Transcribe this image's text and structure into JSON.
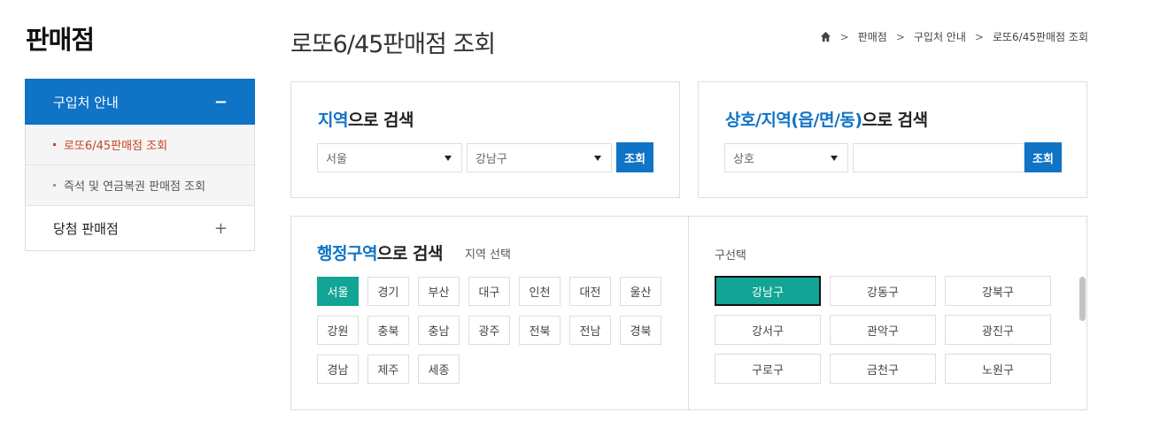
{
  "side_title": "판매점",
  "page_title": "로또6/45판매점 조회",
  "breadcrumb": [
    "판매점",
    "구입처 안내",
    "로또6/45판매점 조회"
  ],
  "sidebar": {
    "head_label": "구입처 안내",
    "head_toggle": "−",
    "subs": [
      "로또6/45판매점 조회",
      "즉석 및 연금복권 판매점 조회"
    ],
    "item_label": "당첨 판매점",
    "item_toggle": "+"
  },
  "region_search": {
    "title_blue": "지역",
    "title_rest": "으로 검색",
    "city_value": "서울",
    "district_value": "강남구",
    "button": "조회"
  },
  "name_search": {
    "title_blue": "상호/지역(읍/면/동)",
    "title_rest": "으로 검색",
    "type_value": "상호",
    "input_value": "",
    "button": "조회"
  },
  "admin_search": {
    "title_blue": "행정구역",
    "title_rest": "으로 검색",
    "sub_label": "지역 선택",
    "regions": [
      "서울",
      "경기",
      "부산",
      "대구",
      "인천",
      "대전",
      "울산",
      "강원",
      "충북",
      "충남",
      "광주",
      "전북",
      "전남",
      "경북",
      "경남",
      "제주",
      "세종"
    ],
    "selected_region": "서울",
    "gu_label": "구선택",
    "gus": [
      "강남구",
      "강동구",
      "강북구",
      "강서구",
      "관악구",
      "광진구",
      "구로구",
      "금천구",
      "노원구"
    ],
    "selected_gu": "강남구"
  },
  "colors": {
    "blue": "#0f73c6",
    "teal": "#12a495",
    "active_red": "#c8431f"
  }
}
